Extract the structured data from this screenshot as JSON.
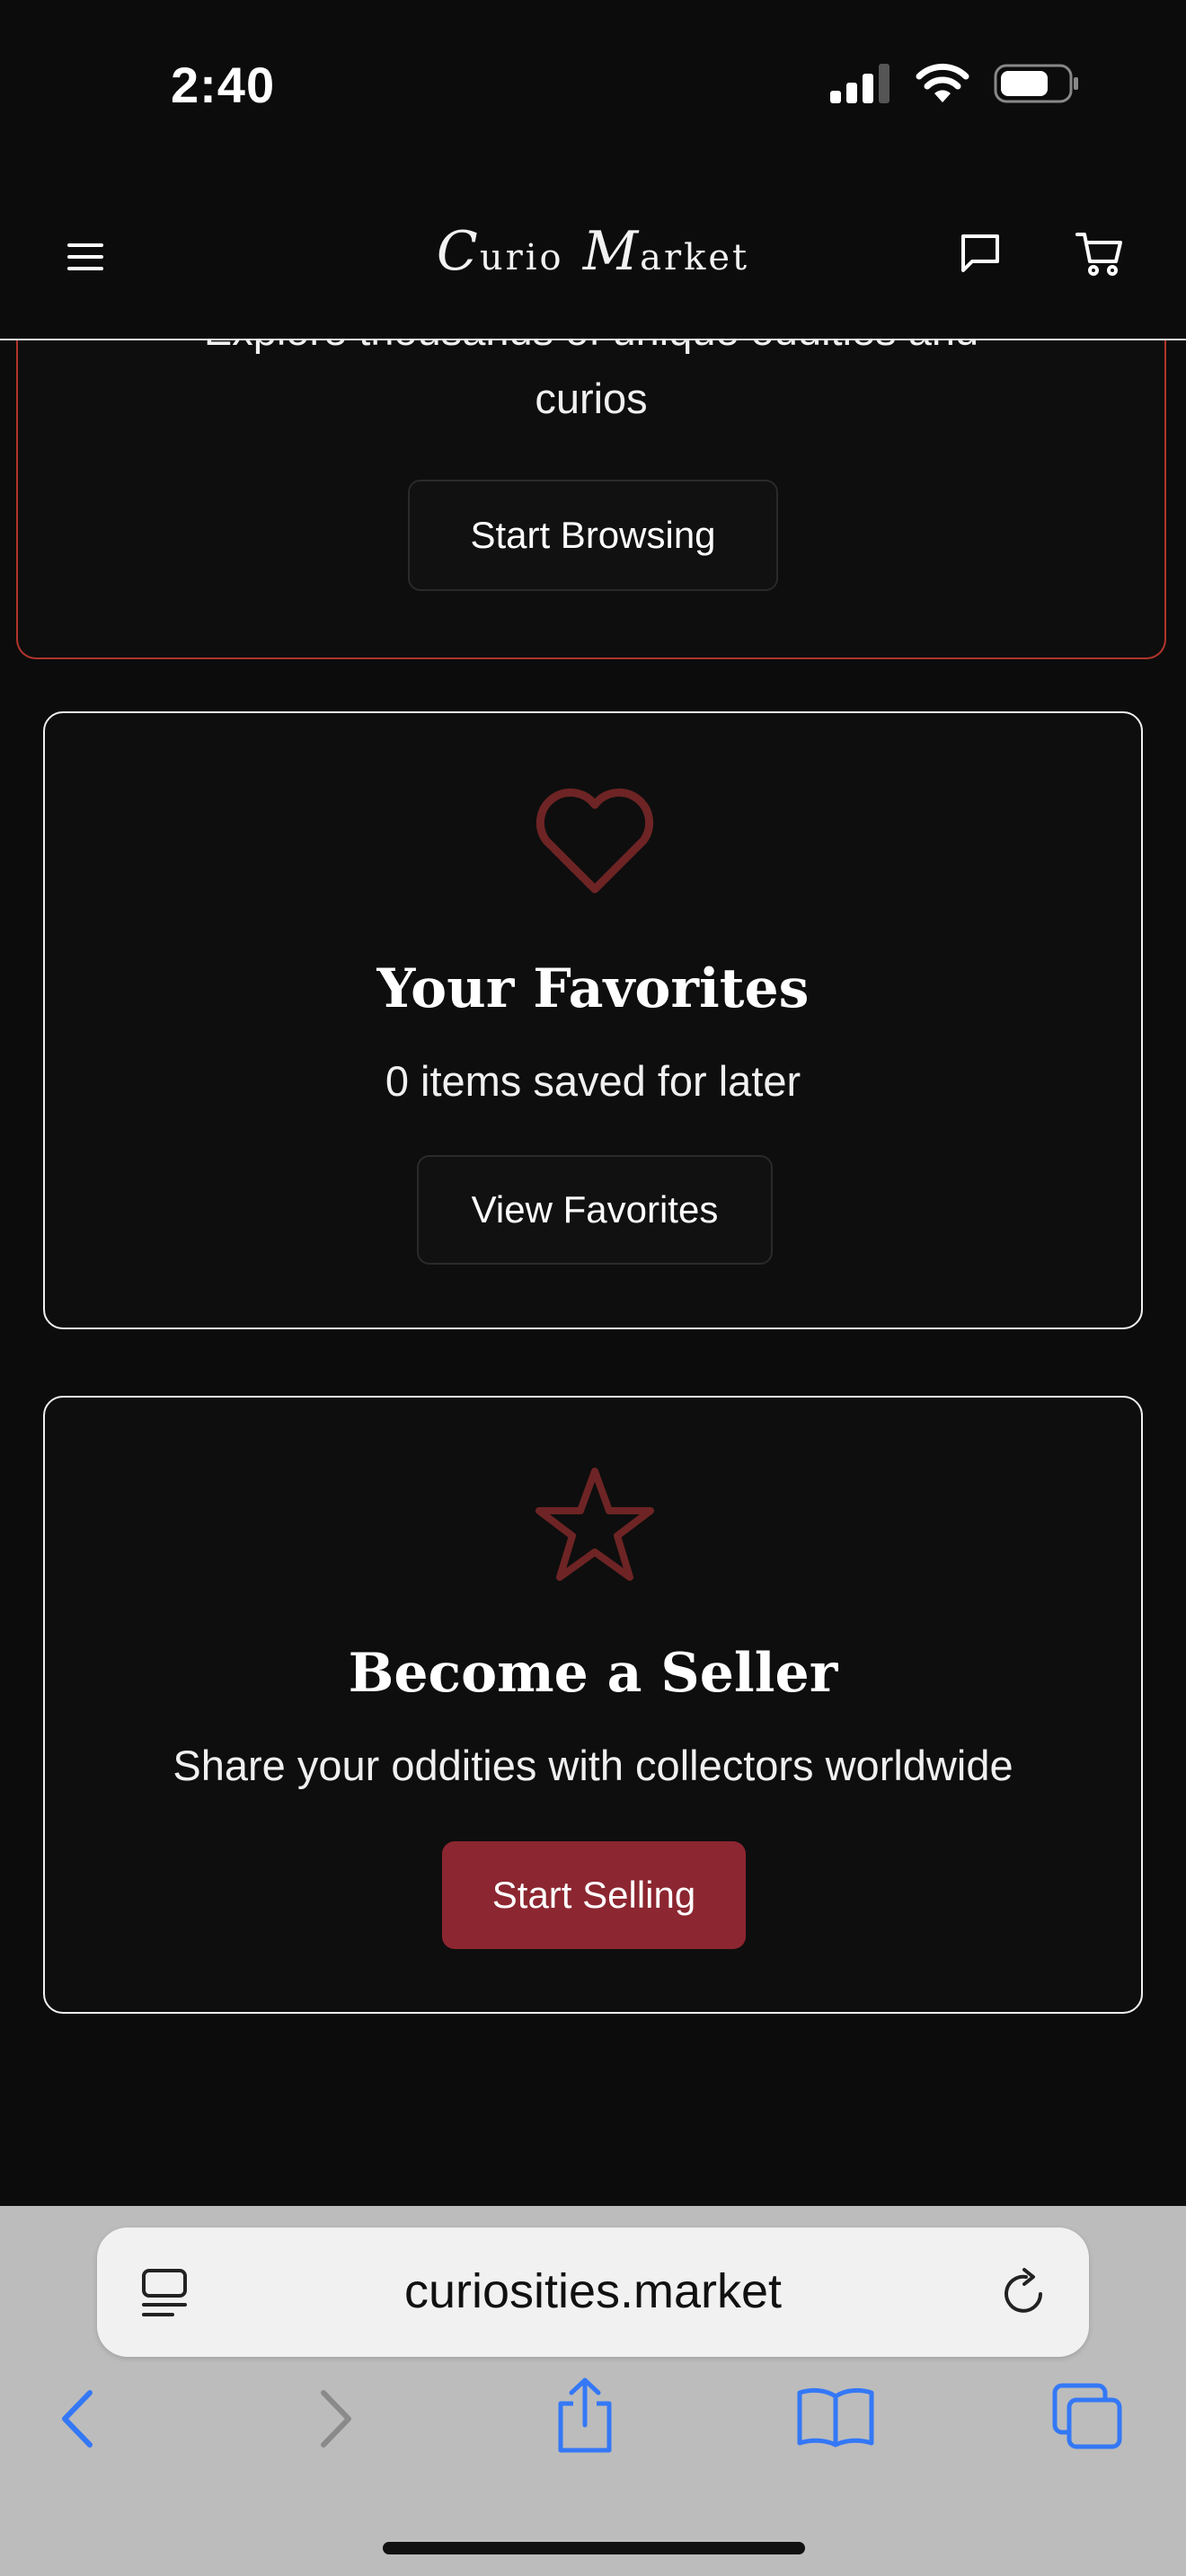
{
  "status_bar": {
    "time": "2:40"
  },
  "header": {
    "logo_first": "C",
    "logo_first_rest": "urio",
    "logo_second": "M",
    "logo_second_rest": "arket"
  },
  "browse_card": {
    "partial_line": "Explore thousands of unique oddities and",
    "text_tail": "curios",
    "button_label": "Start Browsing"
  },
  "favorites_card": {
    "icon": "heart-icon",
    "title": "Your Favorites",
    "subtitle": "0 items saved for later",
    "button_label": "View Favorites"
  },
  "seller_card": {
    "icon": "star-icon",
    "title": "Become a Seller",
    "subtitle": "Share your oddities with collectors worldwide",
    "button_label": "Start Selling"
  },
  "browser": {
    "url": "curiosities.market"
  },
  "colors": {
    "accent_red": "#8c2630",
    "border_red": "#b1342c",
    "icon_red": "#6e2424",
    "background": "#0c0c0c",
    "safari_blue": "#3478f6"
  }
}
